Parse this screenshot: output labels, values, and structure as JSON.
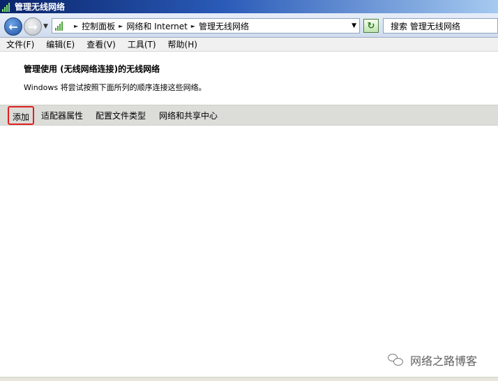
{
  "window": {
    "title": "管理无线网络"
  },
  "address": {
    "crumbs": [
      "控制面板",
      "网络和 Internet",
      "管理无线网络"
    ],
    "search_placeholder": "搜索 管理无线网络"
  },
  "menu": [
    "文件(F)",
    "编辑(E)",
    "查看(V)",
    "工具(T)",
    "帮助(H)"
  ],
  "header": {
    "title": "管理使用 (无线网络连接)的无线网络",
    "description": "Windows 将尝试按照下面所列的顺序连接这些网络。"
  },
  "commands": {
    "add": "添加",
    "adapter": "适配器属性",
    "profile": "配置文件类型",
    "center": "网络和共享中心"
  },
  "watermark": "网络之路博客",
  "icons": {
    "back": "back-arrow-icon",
    "forward": "forward-arrow-icon",
    "refresh": "refresh-icon",
    "app": "wireless-signal-icon"
  }
}
